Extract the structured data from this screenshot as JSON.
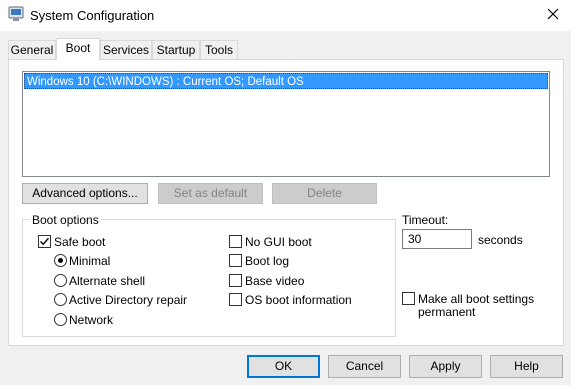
{
  "window": {
    "title": "System Configuration",
    "icon": "msconfig-icon"
  },
  "tabs": [
    {
      "label": "General",
      "active": false
    },
    {
      "label": "Boot",
      "active": true
    },
    {
      "label": "Services",
      "active": false
    },
    {
      "label": "Startup",
      "active": false
    },
    {
      "label": "Tools",
      "active": false
    }
  ],
  "boot_list": {
    "items": [
      "Windows 10 (C:\\WINDOWS) : Current OS; Default OS"
    ],
    "selected_index": 0
  },
  "list_buttons": {
    "advanced": "Advanced options...",
    "set_default": "Set as default",
    "delete": "Delete"
  },
  "boot_options": {
    "group_label": "Boot options",
    "safe_boot": {
      "label": "Safe boot",
      "checked": true
    },
    "radios": [
      {
        "label": "Minimal",
        "selected": true
      },
      {
        "label": "Alternate shell",
        "selected": false
      },
      {
        "label": "Active Directory repair",
        "selected": false
      },
      {
        "label": "Network",
        "selected": false
      }
    ],
    "right_checks": [
      {
        "label": "No GUI boot",
        "checked": false
      },
      {
        "label": "Boot log",
        "checked": false
      },
      {
        "label": "Base video",
        "checked": false
      },
      {
        "label": "OS boot information",
        "checked": false
      }
    ]
  },
  "timeout": {
    "label": "Timeout:",
    "value": "30",
    "unit": "seconds"
  },
  "make_permanent": {
    "line1": "Make all boot settings",
    "line2": "permanent",
    "checked": false
  },
  "footer": {
    "ok": "OK",
    "cancel": "Cancel",
    "apply": "Apply",
    "help": "Help"
  },
  "colors": {
    "selection": "#3399ff",
    "default_button_border": "#0078d7"
  }
}
